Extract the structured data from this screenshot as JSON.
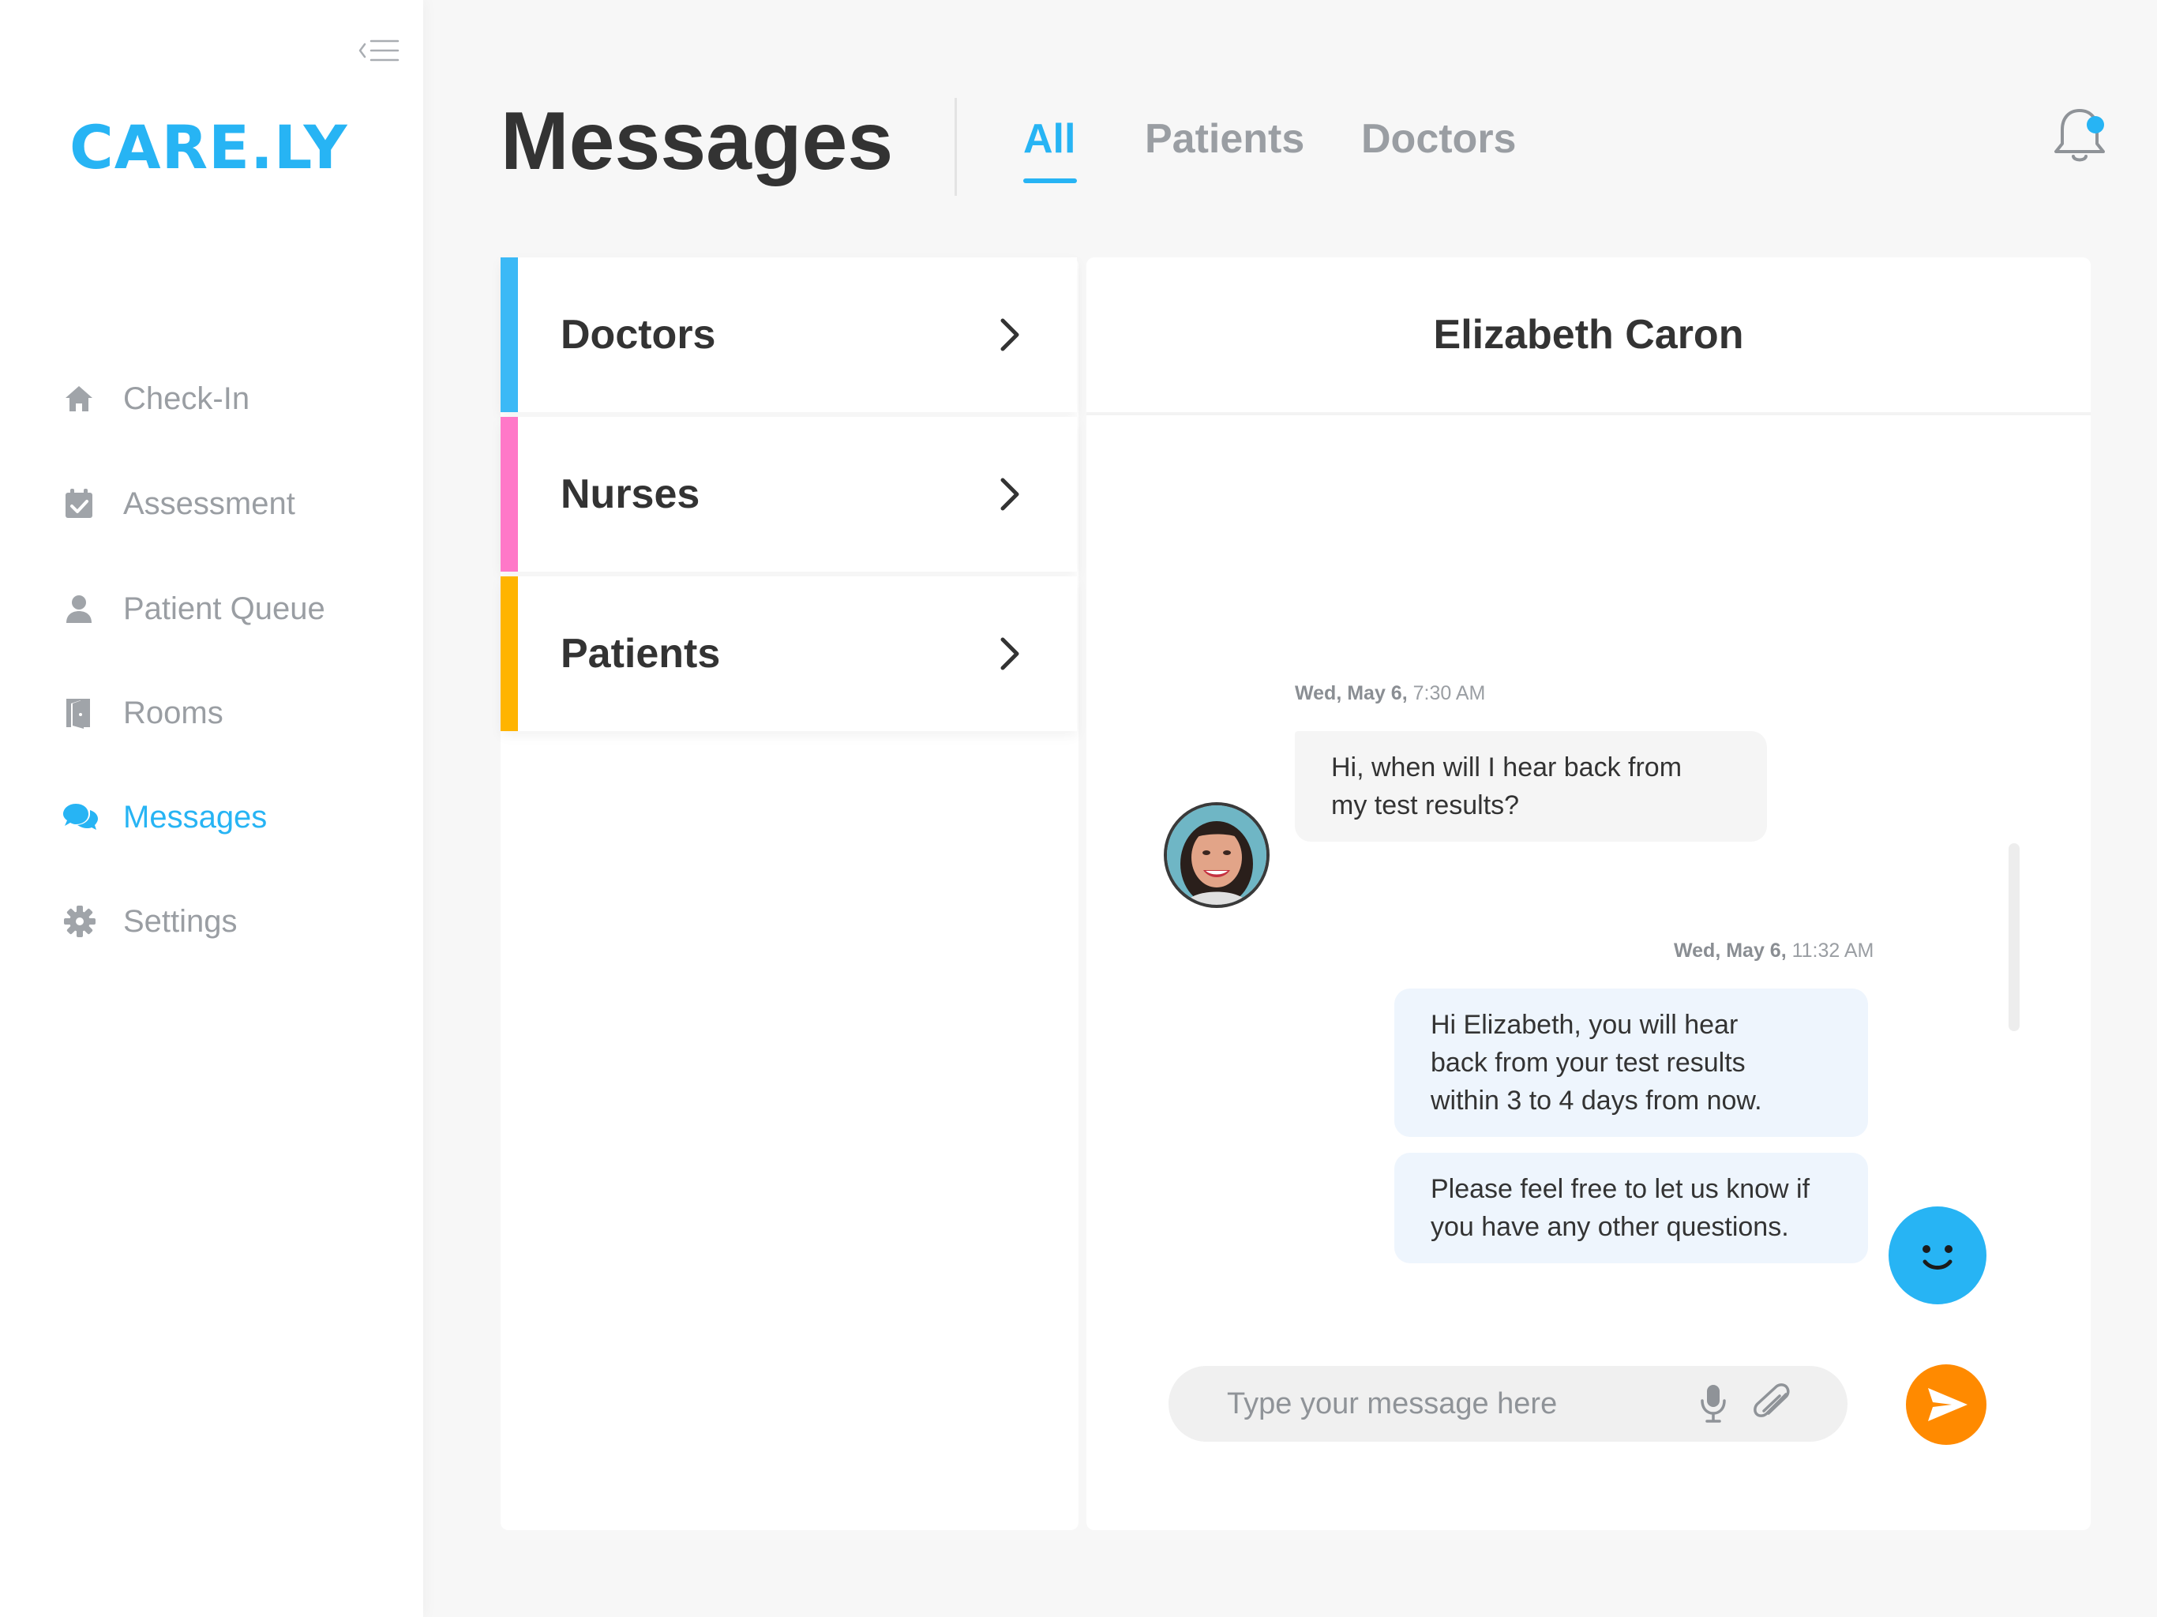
{
  "app": {
    "logo": "CARE.LY",
    "accent_color": "#27b4f4"
  },
  "sidebar": {
    "collapse_icon": "menu-collapse-icon",
    "items": [
      {
        "label": "Check-In",
        "icon": "home-icon",
        "active": false
      },
      {
        "label": "Assessment",
        "icon": "calendar-check-icon",
        "active": false
      },
      {
        "label": "Patient Queue",
        "icon": "person-icon",
        "active": false
      },
      {
        "label": "Rooms",
        "icon": "door-icon",
        "active": false
      },
      {
        "label": "Messages",
        "icon": "chat-bubbles-icon",
        "active": true
      },
      {
        "label": "Settings",
        "icon": "gear-icon",
        "active": false
      }
    ]
  },
  "header": {
    "title": "Messages",
    "tabs": [
      {
        "label": "All",
        "active": true
      },
      {
        "label": "Patients",
        "active": false
      },
      {
        "label": "Doctors",
        "active": false
      }
    ],
    "notification_icon": "bell-icon",
    "notification_dot_color": "#27b4f4"
  },
  "categories": [
    {
      "label": "Doctors",
      "color": "#3bb9f6"
    },
    {
      "label": "Nurses",
      "color": "#ff78c8"
    },
    {
      "label": "Patients",
      "color": "#ffb400"
    }
  ],
  "chat": {
    "contact_name": "Elizabeth Caron",
    "messages": [
      {
        "direction": "incoming",
        "date": "Wed, May 6,",
        "time": "7:30 AM",
        "lines": [
          "Hi, when will I hear back from",
          "my test results?"
        ]
      },
      {
        "direction": "outgoing",
        "date": "Wed, May 6,",
        "time": "11:32 AM",
        "lines": [
          "Hi Elizabeth, you will hear",
          "back from your test results",
          "within 3 to 4 days from now."
        ]
      },
      {
        "direction": "outgoing",
        "lines": [
          "Please feel free to let us know if",
          "you have any other questions."
        ]
      }
    ],
    "input": {
      "placeholder": "Type your message here",
      "value": ""
    },
    "send_color": "#ff8a00"
  }
}
